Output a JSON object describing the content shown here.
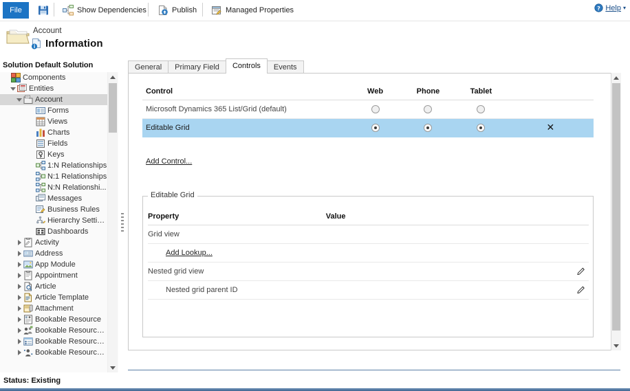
{
  "ribbon": {
    "file_label": "File",
    "save_icon": "save-floppy-icon",
    "items": [
      {
        "label": "Show Dependencies",
        "icon": "dependencies-icon"
      },
      {
        "label": "Publish",
        "icon": "publish-icon"
      },
      {
        "label": "Managed Properties",
        "icon": "managed-properties-icon"
      }
    ],
    "help_label": "Help",
    "help_icon": "help-circle-icon",
    "help_caret": "▾"
  },
  "header": {
    "entity": "Account",
    "title": "Information",
    "folder_icon": "folder-icon",
    "info_icon": "information-icon"
  },
  "sidebar": {
    "solution_header": "Solution Default Solution",
    "tree": [
      {
        "label": "Components",
        "icon": "components-icon",
        "depth": 0,
        "toggle": "",
        "selected": false
      },
      {
        "label": "Entities",
        "icon": "entities-icon",
        "depth": 1,
        "toggle": "open",
        "selected": false
      },
      {
        "label": "Account",
        "icon": "account-entity-icon",
        "depth": 2,
        "toggle": "open",
        "selected": true
      },
      {
        "label": "Forms",
        "icon": "forms-icon",
        "depth": 4,
        "toggle": "",
        "selected": false
      },
      {
        "label": "Views",
        "icon": "views-icon",
        "depth": 4,
        "toggle": "",
        "selected": false
      },
      {
        "label": "Charts",
        "icon": "charts-icon",
        "depth": 4,
        "toggle": "",
        "selected": false
      },
      {
        "label": "Fields",
        "icon": "fields-icon",
        "depth": 4,
        "toggle": "",
        "selected": false
      },
      {
        "label": "Keys",
        "icon": "keys-icon",
        "depth": 4,
        "toggle": "",
        "selected": false
      },
      {
        "label": "1:N Relationships",
        "icon": "one-to-many-icon",
        "depth": 4,
        "toggle": "",
        "selected": false
      },
      {
        "label": "N:1 Relationships",
        "icon": "many-to-one-icon",
        "depth": 4,
        "toggle": "",
        "selected": false
      },
      {
        "label": "N:N Relationshi...",
        "icon": "many-to-many-icon",
        "depth": 4,
        "toggle": "",
        "selected": false
      },
      {
        "label": "Messages",
        "icon": "messages-icon",
        "depth": 4,
        "toggle": "",
        "selected": false
      },
      {
        "label": "Business Rules",
        "icon": "business-rules-icon",
        "depth": 4,
        "toggle": "",
        "selected": false
      },
      {
        "label": "Hierarchy Settin...",
        "icon": "hierarchy-settings-icon",
        "depth": 4,
        "toggle": "",
        "selected": false
      },
      {
        "label": "Dashboards",
        "icon": "dashboards-icon",
        "depth": 4,
        "toggle": "",
        "selected": false
      },
      {
        "label": "Activity",
        "icon": "activity-icon",
        "depth": 2,
        "toggle": "closed",
        "selected": false
      },
      {
        "label": "Address",
        "icon": "address-icon",
        "depth": 2,
        "toggle": "closed",
        "selected": false
      },
      {
        "label": "App Module",
        "icon": "app-module-icon",
        "depth": 2,
        "toggle": "closed",
        "selected": false
      },
      {
        "label": "Appointment",
        "icon": "appointment-icon",
        "depth": 2,
        "toggle": "closed",
        "selected": false
      },
      {
        "label": "Article",
        "icon": "article-icon",
        "depth": 2,
        "toggle": "closed",
        "selected": false
      },
      {
        "label": "Article Template",
        "icon": "article-template-icon",
        "depth": 2,
        "toggle": "closed",
        "selected": false
      },
      {
        "label": "Attachment",
        "icon": "attachment-icon",
        "depth": 2,
        "toggle": "closed",
        "selected": false
      },
      {
        "label": "Bookable Resource",
        "icon": "bookable-resource-icon",
        "depth": 2,
        "toggle": "closed",
        "selected": false
      },
      {
        "label": "Bookable Resource ...",
        "icon": "bookable-resource-group-icon",
        "depth": 2,
        "toggle": "closed",
        "selected": false
      },
      {
        "label": "Bookable Resource ...",
        "icon": "bookable-resource-booking-icon",
        "depth": 2,
        "toggle": "closed",
        "selected": false
      },
      {
        "label": "Bookable Resource ...",
        "icon": "bookable-resource-category-icon",
        "depth": 2,
        "toggle": "closed",
        "selected": false
      }
    ]
  },
  "main": {
    "tabs": [
      {
        "label": "General",
        "active": false
      },
      {
        "label": "Primary Field",
        "active": false
      },
      {
        "label": "Controls",
        "active": true
      },
      {
        "label": "Events",
        "active": false
      }
    ],
    "controls_table": {
      "headers": [
        "Control",
        "Web",
        "Phone",
        "Tablet",
        ""
      ],
      "rows": [
        {
          "name": "Microsoft Dynamics 365 List/Grid (default)",
          "web": false,
          "phone": false,
          "tablet": false,
          "remove": "",
          "selected": false
        },
        {
          "name": "Editable Grid",
          "web": true,
          "phone": true,
          "tablet": true,
          "remove": "✕",
          "selected": true
        }
      ]
    },
    "add_control_label": "Add Control...",
    "properties": {
      "legend": "Editable Grid",
      "headers": [
        "Property",
        "Value"
      ],
      "rows": [
        {
          "name": "Grid view",
          "value": "",
          "indent": 0,
          "edit_icon": "",
          "link": ""
        },
        {
          "name": "",
          "value": "",
          "indent": 1,
          "edit_icon": "",
          "link": "Add Lookup..."
        },
        {
          "name": "Nested grid view",
          "value": "",
          "indent": 0,
          "edit_icon": "pencil-icon",
          "link": ""
        },
        {
          "name": "Nested grid parent ID",
          "value": "",
          "indent": 1,
          "edit_icon": "pencil-icon",
          "link": ""
        }
      ]
    }
  },
  "status": {
    "text": "Status: Existing"
  },
  "colors": {
    "accent": "#1c74c4",
    "selection": "#a9d5f1",
    "tree_selection": "#d7d7d7",
    "status_rule": "#4a6f99"
  }
}
